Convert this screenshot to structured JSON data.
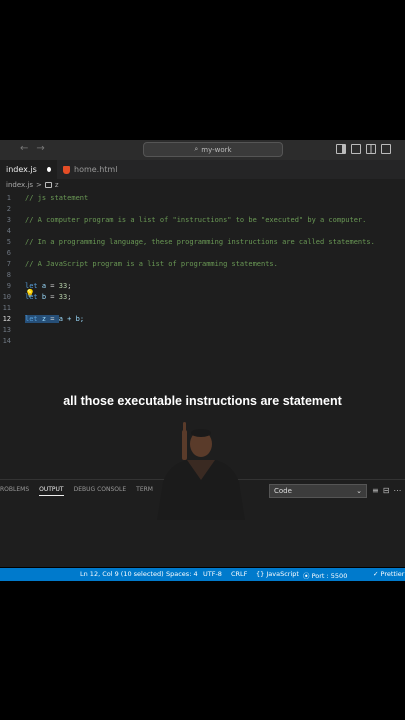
{
  "titlebar": {
    "search_text": "my-work"
  },
  "tabs": [
    {
      "label": "index.js"
    },
    {
      "label": "home.html"
    }
  ],
  "breadcrumb": {
    "file": "index.js",
    "separator": ">",
    "symbol": "z"
  },
  "code_lines": [
    {
      "n": "1",
      "text": "// js statement"
    },
    {
      "n": "2",
      "text": ""
    },
    {
      "n": "3",
      "text": "// A computer program is a list of \"instructions\" to be \"executed\" by a computer."
    },
    {
      "n": "4",
      "text": ""
    },
    {
      "n": "5",
      "text": "// In a programming language, these programming instructions are called statements."
    },
    {
      "n": "6",
      "text": ""
    },
    {
      "n": "7",
      "text": "// A JavaScript program is a list of programming statements."
    },
    {
      "n": "8",
      "text": ""
    },
    {
      "n": "9",
      "kw": "let",
      "var": "a",
      "op": " = ",
      "num": "33",
      "end": ";"
    },
    {
      "n": "10",
      "kw": "let",
      "var": "b",
      "op": " = ",
      "num": "33",
      "end": ";"
    },
    {
      "n": "11",
      "text": ""
    },
    {
      "n": "12",
      "kw": "let",
      "var": "z",
      "op": " = ",
      "rest": "a + b;"
    },
    {
      "n": "13",
      "text": ""
    },
    {
      "n": "14",
      "text": ""
    }
  ],
  "caption": "all those executable instructions are statement",
  "panel": {
    "tabs": [
      "ROBLEMS",
      "OUTPUT",
      "DEBUG CONSOLE",
      "TERM"
    ],
    "active_tab": "OUTPUT",
    "select_value": "Code"
  },
  "statusbar": {
    "position": "Ln 12, Col 9 (10 selected)",
    "spaces": "Spaces: 4",
    "encoding": "UTF-8",
    "eol": "CRLF",
    "language": "JavaScript",
    "port": "Port : 5500",
    "prettier": "Prettier"
  },
  "colors": {
    "accent": "#007acc",
    "selection": "#264f78",
    "comment": "#6a9955",
    "keyword": "#569cd6"
  }
}
